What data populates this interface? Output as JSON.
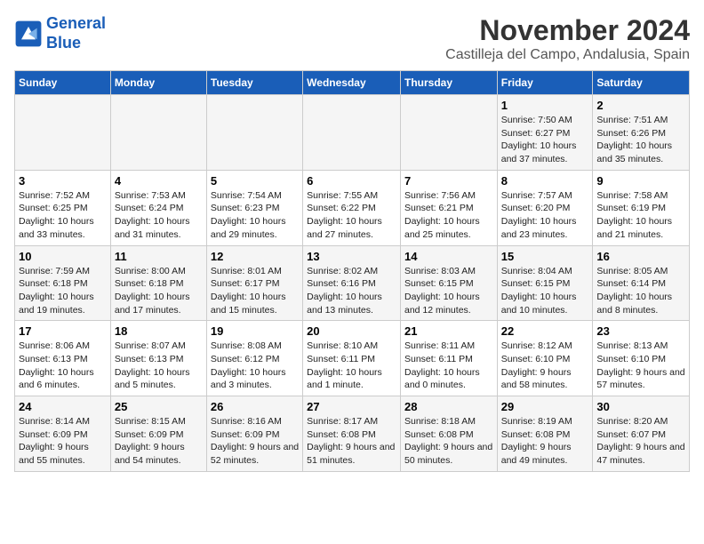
{
  "logo": {
    "line1": "General",
    "line2": "Blue"
  },
  "title": "November 2024",
  "location": "Castilleja del Campo, Andalusia, Spain",
  "days_of_week": [
    "Sunday",
    "Monday",
    "Tuesday",
    "Wednesday",
    "Thursday",
    "Friday",
    "Saturday"
  ],
  "weeks": [
    [
      {
        "day": "",
        "info": ""
      },
      {
        "day": "",
        "info": ""
      },
      {
        "day": "",
        "info": ""
      },
      {
        "day": "",
        "info": ""
      },
      {
        "day": "",
        "info": ""
      },
      {
        "day": "1",
        "info": "Sunrise: 7:50 AM\nSunset: 6:27 PM\nDaylight: 10 hours and 37 minutes."
      },
      {
        "day": "2",
        "info": "Sunrise: 7:51 AM\nSunset: 6:26 PM\nDaylight: 10 hours and 35 minutes."
      }
    ],
    [
      {
        "day": "3",
        "info": "Sunrise: 7:52 AM\nSunset: 6:25 PM\nDaylight: 10 hours and 33 minutes."
      },
      {
        "day": "4",
        "info": "Sunrise: 7:53 AM\nSunset: 6:24 PM\nDaylight: 10 hours and 31 minutes."
      },
      {
        "day": "5",
        "info": "Sunrise: 7:54 AM\nSunset: 6:23 PM\nDaylight: 10 hours and 29 minutes."
      },
      {
        "day": "6",
        "info": "Sunrise: 7:55 AM\nSunset: 6:22 PM\nDaylight: 10 hours and 27 minutes."
      },
      {
        "day": "7",
        "info": "Sunrise: 7:56 AM\nSunset: 6:21 PM\nDaylight: 10 hours and 25 minutes."
      },
      {
        "day": "8",
        "info": "Sunrise: 7:57 AM\nSunset: 6:20 PM\nDaylight: 10 hours and 23 minutes."
      },
      {
        "day": "9",
        "info": "Sunrise: 7:58 AM\nSunset: 6:19 PM\nDaylight: 10 hours and 21 minutes."
      }
    ],
    [
      {
        "day": "10",
        "info": "Sunrise: 7:59 AM\nSunset: 6:18 PM\nDaylight: 10 hours and 19 minutes."
      },
      {
        "day": "11",
        "info": "Sunrise: 8:00 AM\nSunset: 6:18 PM\nDaylight: 10 hours and 17 minutes."
      },
      {
        "day": "12",
        "info": "Sunrise: 8:01 AM\nSunset: 6:17 PM\nDaylight: 10 hours and 15 minutes."
      },
      {
        "day": "13",
        "info": "Sunrise: 8:02 AM\nSunset: 6:16 PM\nDaylight: 10 hours and 13 minutes."
      },
      {
        "day": "14",
        "info": "Sunrise: 8:03 AM\nSunset: 6:15 PM\nDaylight: 10 hours and 12 minutes."
      },
      {
        "day": "15",
        "info": "Sunrise: 8:04 AM\nSunset: 6:15 PM\nDaylight: 10 hours and 10 minutes."
      },
      {
        "day": "16",
        "info": "Sunrise: 8:05 AM\nSunset: 6:14 PM\nDaylight: 10 hours and 8 minutes."
      }
    ],
    [
      {
        "day": "17",
        "info": "Sunrise: 8:06 AM\nSunset: 6:13 PM\nDaylight: 10 hours and 6 minutes."
      },
      {
        "day": "18",
        "info": "Sunrise: 8:07 AM\nSunset: 6:13 PM\nDaylight: 10 hours and 5 minutes."
      },
      {
        "day": "19",
        "info": "Sunrise: 8:08 AM\nSunset: 6:12 PM\nDaylight: 10 hours and 3 minutes."
      },
      {
        "day": "20",
        "info": "Sunrise: 8:10 AM\nSunset: 6:11 PM\nDaylight: 10 hours and 1 minute."
      },
      {
        "day": "21",
        "info": "Sunrise: 8:11 AM\nSunset: 6:11 PM\nDaylight: 10 hours and 0 minutes."
      },
      {
        "day": "22",
        "info": "Sunrise: 8:12 AM\nSunset: 6:10 PM\nDaylight: 9 hours and 58 minutes."
      },
      {
        "day": "23",
        "info": "Sunrise: 8:13 AM\nSunset: 6:10 PM\nDaylight: 9 hours and 57 minutes."
      }
    ],
    [
      {
        "day": "24",
        "info": "Sunrise: 8:14 AM\nSunset: 6:09 PM\nDaylight: 9 hours and 55 minutes."
      },
      {
        "day": "25",
        "info": "Sunrise: 8:15 AM\nSunset: 6:09 PM\nDaylight: 9 hours and 54 minutes."
      },
      {
        "day": "26",
        "info": "Sunrise: 8:16 AM\nSunset: 6:09 PM\nDaylight: 9 hours and 52 minutes."
      },
      {
        "day": "27",
        "info": "Sunrise: 8:17 AM\nSunset: 6:08 PM\nDaylight: 9 hours and 51 minutes."
      },
      {
        "day": "28",
        "info": "Sunrise: 8:18 AM\nSunset: 6:08 PM\nDaylight: 9 hours and 50 minutes."
      },
      {
        "day": "29",
        "info": "Sunrise: 8:19 AM\nSunset: 6:08 PM\nDaylight: 9 hours and 49 minutes."
      },
      {
        "day": "30",
        "info": "Sunrise: 8:20 AM\nSunset: 6:07 PM\nDaylight: 9 hours and 47 minutes."
      }
    ]
  ]
}
